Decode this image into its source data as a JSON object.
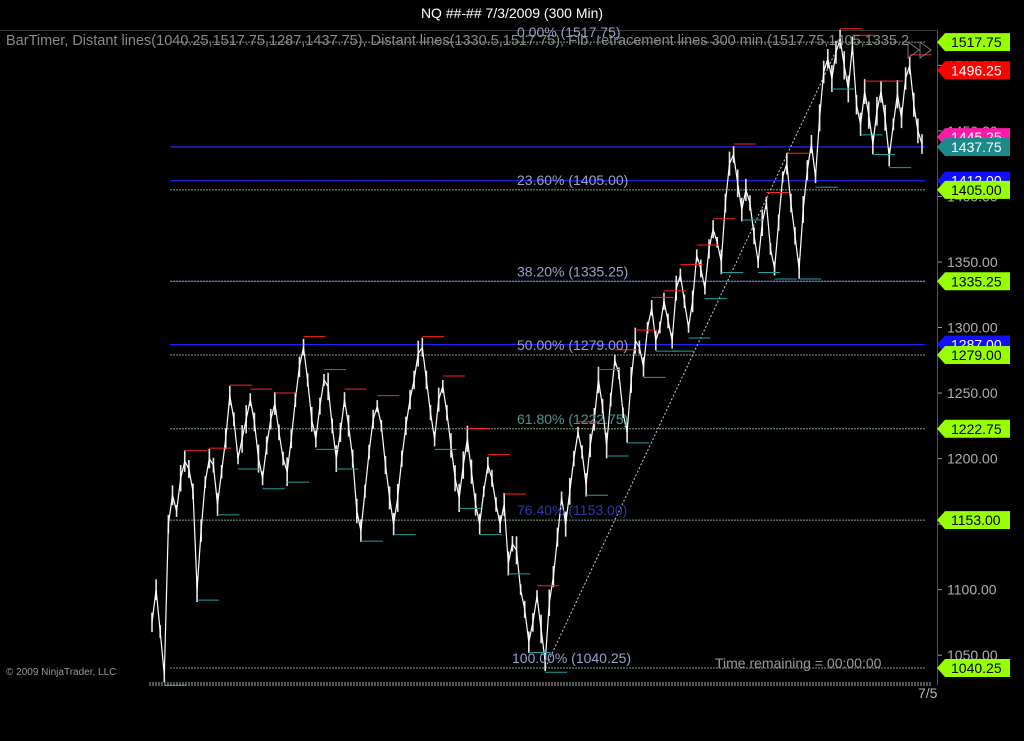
{
  "window": {
    "title": "NQ ##-##  7/3/2009 (300 Min)"
  },
  "header": {
    "indicators": "BarTimer, Distant lines(1040.25,1517.75,1287,1437.75), Distant lines(1330.5,1517.75), Fib. retracement lines 300 min.(1517.75,1405,1335.2"
  },
  "footer": {
    "copyright": "© 2009 NinjaTrader, LLC",
    "time_remaining": "Time remaining = 00:00:00",
    "date_label": "7/5"
  },
  "colors": {
    "background": "#000000",
    "fib_line": "#7f9f7f",
    "distant_line": "#2020ff",
    "swing_high_mark": "#ff2020",
    "swing_low_mark": "#20a0a0",
    "price_green": "#98ff00",
    "price_red": "#ff0000",
    "price_magenta": "#ff1aa8",
    "price_blue": "#1010ff"
  },
  "chart_data": {
    "type": "line",
    "title": "NQ ##-##  7/3/2009 (300 Min)",
    "xlabel": "",
    "ylabel": "",
    "ylim": [
      1028,
      1527
    ],
    "y_ticks": [
      "1050.00",
      "1100.00",
      "1150.00",
      "1200.00",
      "1250.00",
      "1300.00",
      "1350.00",
      "1400.00",
      "1450.00",
      "1500.00"
    ],
    "y_tick_values": [
      1050,
      1100,
      1150,
      1200,
      1250,
      1300,
      1350,
      1400,
      1450,
      1500
    ],
    "x_ticks": [
      "7/5"
    ],
    "grid": false,
    "fib_levels": [
      {
        "label": "0.00% (1517.75)",
        "value": 1517.75
      },
      {
        "label": "23.60% (1405.00)",
        "value": 1405.0
      },
      {
        "label": "38.20% (1335.25)",
        "value": 1335.25
      },
      {
        "label": "50.00% (1279.00)",
        "value": 1279.0
      },
      {
        "label": "61.80% (1222.75)",
        "value": 1222.75
      },
      {
        "label": "76.40% (1153.00)",
        "value": 1153.0
      },
      {
        "label": "100.00% (1040.25)",
        "value": 1040.25
      }
    ],
    "distant_lines": [
      1437.75,
      1412.0,
      1335.25,
      1287.0
    ],
    "price_markers": [
      {
        "label": "1517.75",
        "value": 1517.75,
        "color": "#98ff00"
      },
      {
        "label": "1496.25",
        "value": 1496.25,
        "color": "#ff0000"
      },
      {
        "label": "1445.25",
        "value": 1445.25,
        "color": "#ff1aa8"
      },
      {
        "label": "1437.75",
        "value": 1437.75,
        "color": "#1a8a8a"
      },
      {
        "label": "1412.00",
        "value": 1412.0,
        "color": "#1010ff"
      },
      {
        "label": "1405.00",
        "value": 1405.0,
        "color": "#98ff00"
      },
      {
        "label": "1335.25",
        "value": 1335.25,
        "color": "#98ff00"
      },
      {
        "label": "1287.00",
        "value": 1287.0,
        "color": "#1010ff"
      },
      {
        "label": "1279.00",
        "value": 1279.0,
        "color": "#98ff00"
      },
      {
        "label": "1222.75",
        "value": 1222.75,
        "color": "#98ff00"
      },
      {
        "label": "1153.00",
        "value": 1153.0,
        "color": "#98ff00"
      },
      {
        "label": "1040.25",
        "value": 1040.25,
        "color": "#98ff00"
      }
    ],
    "fib_anchor": {
      "low": 1040.25,
      "high": 1517.75
    },
    "series": [
      {
        "values": [
          1075,
          1100,
          1068,
          1035,
          1150,
          1172,
          1160,
          1185,
          1198,
          1192,
          1175,
          1100,
          1145,
          1182,
          1200,
          1195,
          1165,
          1190,
          1215,
          1248,
          1230,
          1200,
          1215,
          1230,
          1245,
          1228,
          1200,
          1185,
          1210,
          1230,
          1242,
          1220,
          1200,
          1190,
          1215,
          1245,
          1270,
          1285,
          1260,
          1230,
          1215,
          1240,
          1260,
          1255,
          1225,
          1200,
          1220,
          1245,
          1225,
          1200,
          1160,
          1145,
          1175,
          1205,
          1230,
          1240,
          1225,
          1195,
          1170,
          1150,
          1170,
          1200,
          1225,
          1245,
          1260,
          1280,
          1285,
          1260,
          1235,
          1215,
          1245,
          1255,
          1235,
          1210,
          1185,
          1170,
          1195,
          1215,
          1190,
          1165,
          1150,
          1175,
          1195,
          1185,
          1165,
          1150,
          1165,
          1120,
          1135,
          1130,
          1100,
          1085,
          1060,
          1075,
          1095,
          1070,
          1045,
          1090,
          1110,
          1140,
          1170,
          1150,
          1175,
          1200,
          1220,
          1205,
          1180,
          1210,
          1230,
          1260,
          1240,
          1210,
          1245,
          1275,
          1265,
          1235,
          1220,
          1260,
          1290,
          1285,
          1270,
          1300,
          1315,
          1290,
          1300,
          1320,
          1305,
          1290,
          1330,
          1340,
          1320,
          1300,
          1320,
          1355,
          1345,
          1330,
          1360,
          1375,
          1365,
          1350,
          1395,
          1425,
          1432,
          1410,
          1390,
          1405,
          1395,
          1370,
          1350,
          1380,
          1395,
          1360,
          1345,
          1380,
          1415,
          1425,
          1395,
          1370,
          1345,
          1390,
          1420,
          1440,
          1415,
          1460,
          1495,
          1505,
          1490,
          1510,
          1520,
          1500,
          1482,
          1515,
          1470,
          1455,
          1480,
          1462,
          1440,
          1465,
          1480,
          1460,
          1430,
          1455,
          1478,
          1460,
          1490,
          1500,
          1470,
          1450,
          1440
        ]
      }
    ]
  }
}
